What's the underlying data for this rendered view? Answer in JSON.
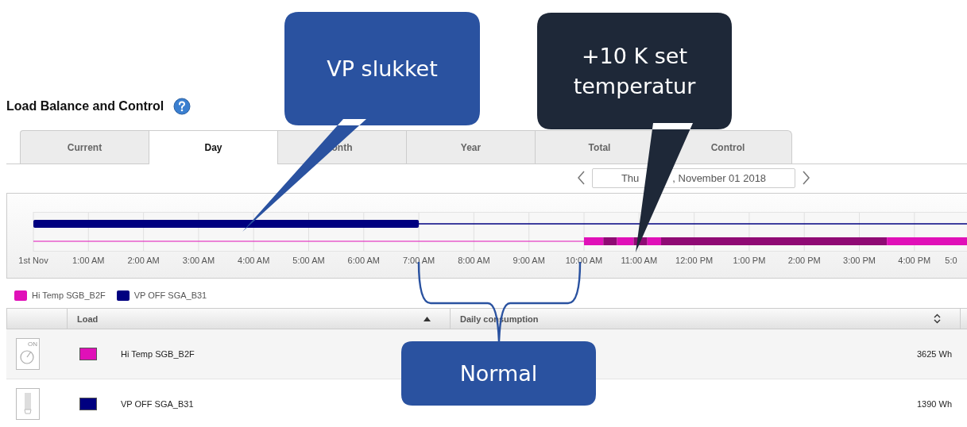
{
  "title": "Load Balance and Control",
  "tabs": [
    {
      "label": "Current",
      "selected": false
    },
    {
      "label": "Day",
      "selected": true
    },
    {
      "label": "onth",
      "selected": false
    },
    {
      "label": "Year",
      "selected": false
    },
    {
      "label": "Total",
      "selected": false
    },
    {
      "label": "Control",
      "selected": false
    }
  ],
  "date_field": {
    "value_start": "Thu",
    "value_end": ", November 01 2018"
  },
  "timeline": {
    "axis_labels": [
      "1st Nov",
      "1:00 AM",
      "2:00 AM",
      "3:00 AM",
      "4:00 AM",
      "5:00 AM",
      "6:00 AM",
      "7:00 AM",
      "8:00 AM",
      "9:00 AM",
      "10:00 AM",
      "11:00 AM",
      "12:00 PM",
      "1:00 PM",
      "2:00 PM",
      "3:00 PM",
      "4:00 PM",
      "5:0"
    ]
  },
  "legend": [
    {
      "label": "Hi Temp SGB_B2F",
      "color": "#e010b8"
    },
    {
      "label": "VP OFF SGA_B31",
      "color": "#000080"
    }
  ],
  "table": {
    "columns": [
      {
        "label": "Load",
        "sorted": true
      },
      {
        "label": "Daily consumption",
        "sorted": false
      }
    ],
    "rows": [
      {
        "kind": "dial",
        "icon_label": "ON",
        "color": "#e010b8",
        "name": "Hi Temp SGB_B2F",
        "consumption": "3625 Wh"
      },
      {
        "kind": "lamp",
        "color": "#000080",
        "name": "VP OFF SGA_B31",
        "consumption": "1390 Wh"
      }
    ]
  },
  "annotations": [
    {
      "kind": "bubble",
      "text": "VP slukket",
      "color": "#2a52a0"
    },
    {
      "kind": "bubble",
      "text": "+10 K set temperatur",
      "color": "#1e2838"
    },
    {
      "kind": "bracket",
      "text": "Normal",
      "color": "#2a52a0"
    }
  ]
}
